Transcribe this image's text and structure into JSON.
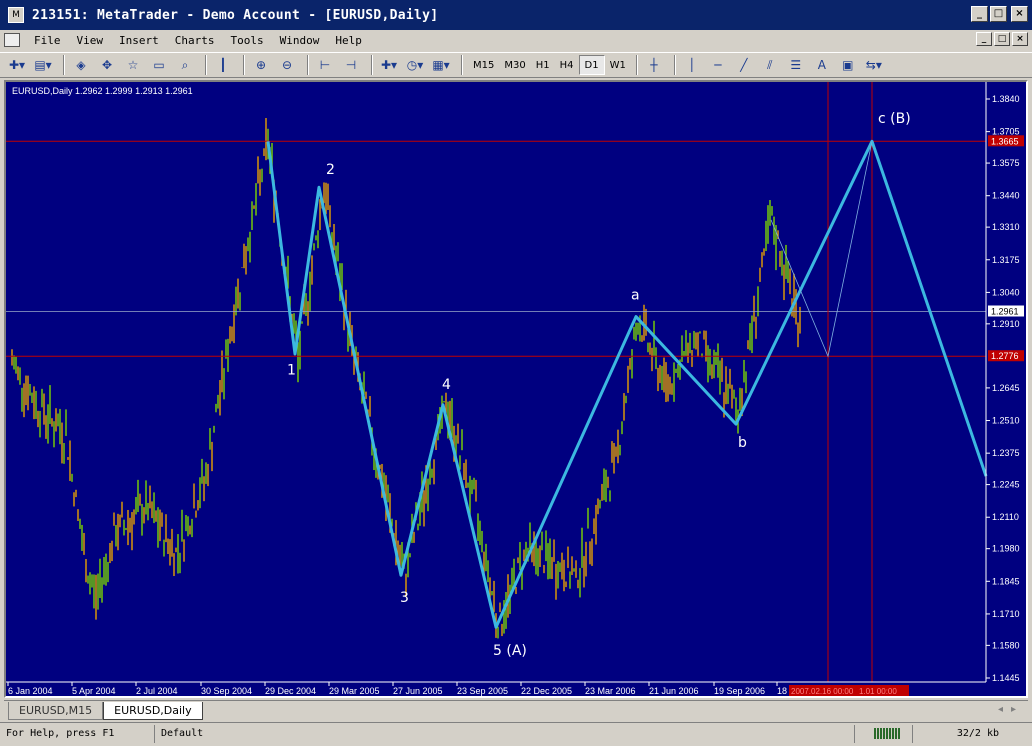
{
  "window": {
    "title": "213151: MetaTrader - Demo Account - [EURUSD,Daily]",
    "buttons": [
      "_",
      "□",
      "×"
    ],
    "mdi_buttons": [
      "_",
      "□",
      "×"
    ]
  },
  "menu": [
    "File",
    "View",
    "Insert",
    "Charts",
    "Tools",
    "Window",
    "Help"
  ],
  "toolbar": {
    "timeframes": [
      "M15",
      "M30",
      "H1",
      "H4",
      "D1",
      "W1"
    ],
    "active_timeframe": "D1",
    "icons": [
      "new-chart-icon",
      "profiles-icon",
      "market-watch-icon",
      "navigator-icon",
      "favorites-icon",
      "terminal-icon",
      "tester-icon",
      "candles-icon",
      "zoom-in-icon",
      "zoom-out-icon",
      "autoscroll-icon",
      "chart-shift-icon",
      "indicators-icon",
      "periods-icon",
      "templates-icon",
      "crosshair-icon",
      "vertical-line-icon",
      "horizontal-line-icon",
      "trendline-icon",
      "channel-icon",
      "fibonacci-icon",
      "text-icon",
      "label-icon",
      "arrows-icon"
    ],
    "text_tool": "A"
  },
  "chart": {
    "info": "EURUSD,Daily  1.2962 1.2999 1.2913 1.2961",
    "price_labels": [
      "1.3840",
      "1.3705",
      "1.3575",
      "1.3440",
      "1.3310",
      "1.3175",
      "1.3040",
      "1.2910",
      "1.2645",
      "1.2510",
      "1.2375",
      "1.2245",
      "1.2110",
      "1.1980",
      "1.1845",
      "1.1710",
      "1.1580",
      "1.1445"
    ],
    "highlight_prices": {
      "upper": "1.3665",
      "current": "1.2961",
      "lower": "1.2776"
    },
    "date_labels": [
      "6 Jan 2004",
      "5 Apr 2004",
      "2 Jul 2004",
      "30 Sep 2004",
      "29 Dec 2004",
      "29 Mar 2005",
      "27 Jun 2005",
      "23 Sep 2005",
      "22 Dec 2005",
      "23 Mar 2006",
      "21 Jun 2006",
      "19 Sep 2006",
      "18"
    ],
    "date_highlight": "2007.02.16 00:00",
    "date_highlight2": "1.01 00:00",
    "wave_labels": {
      "w1": "1",
      "w2": "2",
      "w3": "3",
      "w4": "4",
      "w5": "5 (A)",
      "wa": "a",
      "wb": "b",
      "wc": "c (B)"
    },
    "colors": {
      "background": "#000080",
      "candle_up": "#7cd600",
      "candle_down": "#e8a000",
      "wave": "#3cb8e0",
      "level": "#c00000"
    }
  },
  "tabs": [
    "EURUSD,M15",
    "EURUSD,Daily"
  ],
  "active_tab": "EURUSD,Daily",
  "status": {
    "help": "For Help, press F1",
    "profile": "Default",
    "traffic": "32/2 kb"
  }
}
